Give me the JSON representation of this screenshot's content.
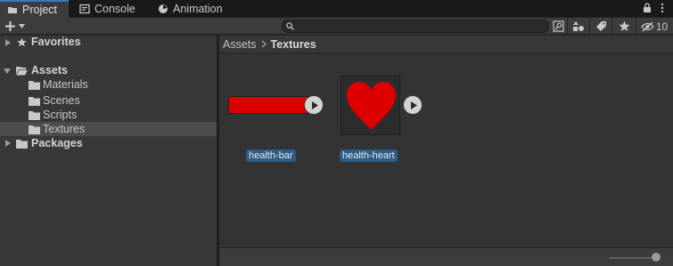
{
  "tabs": [
    {
      "label": "Project",
      "icon": "folder-icon",
      "active": true
    },
    {
      "label": "Console",
      "icon": "console-icon",
      "active": false
    },
    {
      "label": "Animation",
      "icon": "animation-icon",
      "active": false
    }
  ],
  "toolbar": {
    "search_placeholder": "",
    "hidden_count": "10"
  },
  "tree": {
    "favorites": "Favorites",
    "assets": "Assets",
    "materials": "Materials",
    "scenes": "Scenes",
    "scripts": "Scripts",
    "textures": "Textures",
    "packages": "Packages"
  },
  "breadcrumb": {
    "root": "Assets",
    "current": "Textures"
  },
  "assets": [
    {
      "label": "health-bar",
      "kind": "sprite-bar",
      "color": "#dd0000"
    },
    {
      "label": "health-heart",
      "kind": "sprite-heart",
      "color": "#dd0000"
    }
  ],
  "colors": {
    "accent": "#3a79bb",
    "selection": "#2c5d87",
    "sprite_red": "#dd0000"
  }
}
